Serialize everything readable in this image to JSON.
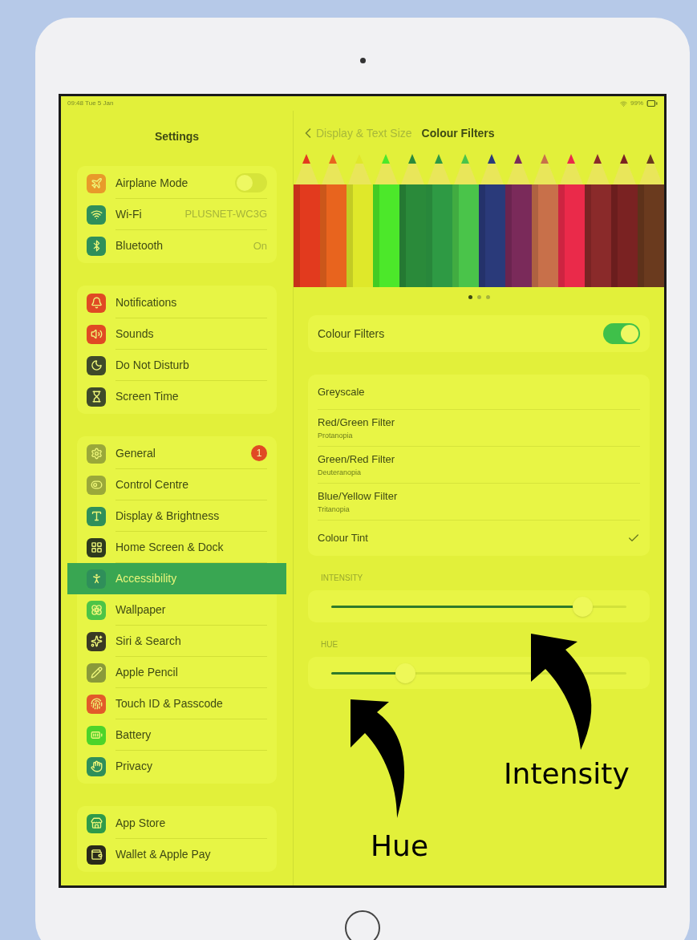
{
  "status_bar": {
    "time": "09:48  Tue 5 Jan",
    "battery": "99%"
  },
  "sidebar": {
    "title": "Settings",
    "groups": [
      {
        "items": [
          {
            "label": "Airplane Mode",
            "kind": "toggle",
            "on": false,
            "selected": false,
            "color": "#e89a2a"
          },
          {
            "label": "Wi-Fi",
            "kind": "value",
            "value": "PLUSNET-WC3G",
            "selected": false,
            "color": "#2f8f5a"
          },
          {
            "label": "Bluetooth",
            "kind": "value",
            "value": "On",
            "selected": false,
            "color": "#2f8f5a"
          }
        ]
      },
      {
        "items": [
          {
            "label": "Notifications",
            "kind": "plain",
            "selected": false,
            "color": "#e04a24"
          },
          {
            "label": "Sounds",
            "kind": "plain",
            "selected": false,
            "color": "#e04a24"
          },
          {
            "label": "Do Not Disturb",
            "kind": "plain",
            "selected": false,
            "color": "#3f4a2a"
          },
          {
            "label": "Screen Time",
            "kind": "plain",
            "selected": false,
            "color": "#3f4a2a"
          }
        ]
      },
      {
        "items": [
          {
            "label": "General",
            "kind": "badge",
            "badge": "1",
            "selected": false,
            "color": "#9aa83a"
          },
          {
            "label": "Control Centre",
            "kind": "plain",
            "selected": false,
            "color": "#9aa83a"
          },
          {
            "label": "Display & Brightness",
            "kind": "plain",
            "selected": false,
            "color": "#2f8f5a"
          },
          {
            "label": "Home Screen & Dock",
            "kind": "plain",
            "selected": false,
            "color": "#2e3a1e"
          },
          {
            "label": "Accessibility",
            "kind": "plain",
            "selected": true,
            "color": "#2f8f5a"
          },
          {
            "label": "Wallpaper",
            "kind": "plain",
            "selected": false,
            "color": "#4cc447"
          },
          {
            "label": "Siri & Search",
            "kind": "plain",
            "selected": false,
            "color": "#3a3a24"
          },
          {
            "label": "Apple Pencil",
            "kind": "plain",
            "selected": false,
            "color": "#8a9a3a"
          },
          {
            "label": "Touch ID & Passcode",
            "kind": "plain",
            "selected": false,
            "color": "#e25a2a"
          },
          {
            "label": "Battery",
            "kind": "plain",
            "selected": false,
            "color": "#4cd42a"
          },
          {
            "label": "Privacy",
            "kind": "plain",
            "selected": false,
            "color": "#2f8f5a"
          }
        ]
      },
      {
        "items": [
          {
            "label": "App Store",
            "kind": "plain",
            "selected": false,
            "color": "#2f9a4a"
          },
          {
            "label": "Wallet & Apple Pay",
            "kind": "plain",
            "selected": false,
            "color": "#2a2a1a"
          }
        ]
      }
    ]
  },
  "detail": {
    "back": "Display & Text Size",
    "title": "Colour Filters",
    "page_dots": [
      {
        "selected": true
      },
      {
        "selected": false
      },
      {
        "selected": false
      }
    ],
    "toggle": {
      "label": "Colour Filters",
      "on": true
    },
    "filters": [
      {
        "label": "Greyscale",
        "selected": false
      },
      {
        "label": "Red/Green Filter",
        "subtitle": "Protanopia",
        "selected": false
      },
      {
        "label": "Green/Red Filter",
        "subtitle": "Deuteranopia",
        "selected": false
      },
      {
        "label": "Blue/Yellow Filter",
        "subtitle": "Tritanopia",
        "selected": false
      },
      {
        "label": "Colour Tint",
        "selected": true
      }
    ],
    "sliders": [
      {
        "label": "INTENSITY",
        "level": 0.85
      },
      {
        "label": "HUE",
        "level": 0.25
      }
    ]
  },
  "annotations": [
    {
      "label": "Intensity"
    },
    {
      "label": "Hue"
    }
  ]
}
